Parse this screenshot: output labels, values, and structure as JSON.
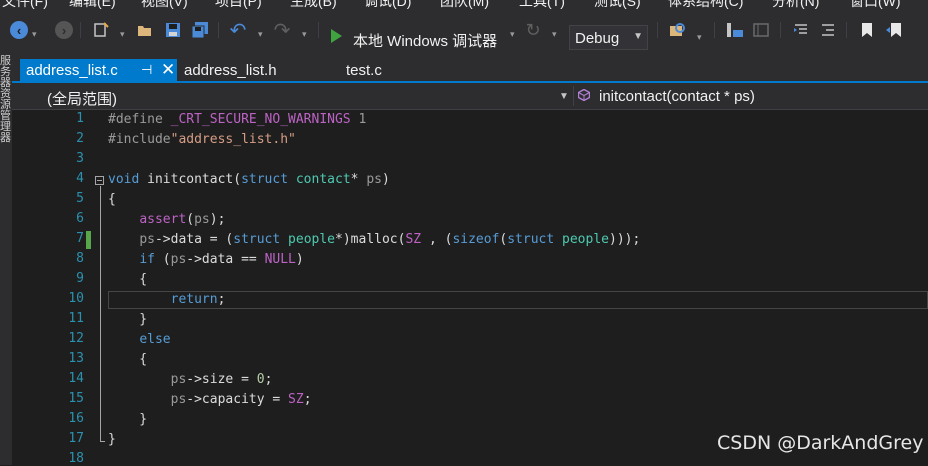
{
  "menu": [
    "文件(F)",
    "编辑(E)",
    "视图(V)",
    "项目(P)",
    "生成(B)",
    "调试(D)",
    "团队(M)",
    "工具(T)",
    "测试(S)",
    "体系结构(C)",
    "分析(N)",
    "窗口(W)"
  ],
  "toolbar": {
    "debugger_label": "本地 Windows 调试器",
    "configuration": "Debug"
  },
  "left_strip_label": "服务器资源管理器",
  "tabs": [
    {
      "label": "address_list.c",
      "active": true,
      "pinned": true
    },
    {
      "label": "address_list.h",
      "active": false
    },
    {
      "label": "test.c",
      "active": false
    }
  ],
  "navbar": {
    "scope": "(全局范围)",
    "member": "initcontact(contact * ps)"
  },
  "editor": {
    "line_numbers": [
      "1",
      "2",
      "3",
      "4",
      "5",
      "6",
      "7",
      "8",
      "9",
      "10",
      "11",
      "12",
      "13",
      "14",
      "15",
      "16",
      "17",
      "18"
    ],
    "lines": [
      [
        {
          "t": "#define ",
          "c": "pp"
        },
        {
          "t": "_CRT_SECURE_NO_WARNINGS",
          "c": "mac"
        },
        {
          "t": " 1",
          "c": "pp"
        }
      ],
      [
        {
          "t": "#include",
          "c": "pp"
        },
        {
          "t": "\"address_list.h\"",
          "c": "str"
        }
      ],
      [],
      [
        {
          "t": "void",
          "c": "kw"
        },
        {
          "t": " initcontact(",
          "c": ""
        },
        {
          "t": "struct",
          "c": "kw"
        },
        {
          "t": " ",
          "c": ""
        },
        {
          "t": "contact",
          "c": "typ"
        },
        {
          "t": "* ",
          "c": ""
        },
        {
          "t": "ps",
          "c": "par"
        },
        {
          "t": ")",
          "c": ""
        }
      ],
      [
        {
          "t": "{",
          "c": ""
        }
      ],
      [
        {
          "t": "    ",
          "c": ""
        },
        {
          "t": "assert",
          "c": "mac"
        },
        {
          "t": "(",
          "c": ""
        },
        {
          "t": "ps",
          "c": "par"
        },
        {
          "t": ");",
          "c": ""
        }
      ],
      [
        {
          "t": "    ",
          "c": ""
        },
        {
          "t": "ps",
          "c": "par"
        },
        {
          "t": "->data = (",
          "c": ""
        },
        {
          "t": "struct",
          "c": "kw"
        },
        {
          "t": " ",
          "c": ""
        },
        {
          "t": "people",
          "c": "typ"
        },
        {
          "t": "*)malloc(",
          "c": ""
        },
        {
          "t": "SZ",
          "c": "mac"
        },
        {
          "t": " , (",
          "c": ""
        },
        {
          "t": "sizeof",
          "c": "kw"
        },
        {
          "t": "(",
          "c": ""
        },
        {
          "t": "struct",
          "c": "kw"
        },
        {
          "t": " ",
          "c": ""
        },
        {
          "t": "people",
          "c": "typ"
        },
        {
          "t": ")));",
          "c": ""
        }
      ],
      [
        {
          "t": "    ",
          "c": ""
        },
        {
          "t": "if",
          "c": "kw"
        },
        {
          "t": " (",
          "c": ""
        },
        {
          "t": "ps",
          "c": "par"
        },
        {
          "t": "->data == ",
          "c": ""
        },
        {
          "t": "NULL",
          "c": "mac"
        },
        {
          "t": ")",
          "c": ""
        }
      ],
      [
        {
          "t": "    {",
          "c": ""
        }
      ],
      [
        {
          "t": "        ",
          "c": ""
        },
        {
          "t": "return",
          "c": "kw"
        },
        {
          "t": ";",
          "c": ""
        }
      ],
      [
        {
          "t": "    }",
          "c": ""
        }
      ],
      [
        {
          "t": "    ",
          "c": ""
        },
        {
          "t": "else",
          "c": "kw"
        }
      ],
      [
        {
          "t": "    {",
          "c": ""
        }
      ],
      [
        {
          "t": "        ",
          "c": ""
        },
        {
          "t": "ps",
          "c": "par"
        },
        {
          "t": "->size = ",
          "c": ""
        },
        {
          "t": "0",
          "c": "num"
        },
        {
          "t": ";",
          "c": ""
        }
      ],
      [
        {
          "t": "        ",
          "c": ""
        },
        {
          "t": "ps",
          "c": "par"
        },
        {
          "t": "->capacity = ",
          "c": ""
        },
        {
          "t": "SZ",
          "c": "mac"
        },
        {
          "t": ";",
          "c": ""
        }
      ],
      [
        {
          "t": "    }",
          "c": ""
        }
      ],
      [
        {
          "t": "}",
          "c": ""
        }
      ],
      []
    ],
    "current_line": "10",
    "changed_line": "7"
  },
  "watermark": "CSDN @DarkAndGrey",
  "colors": {
    "accent": "#007acc",
    "keyword": "#569cd6",
    "macro": "#bd63c5",
    "string": "#d69d85",
    "type": "#4ec9b0",
    "line_number": "#2b91af",
    "change_marker": "#57a64a"
  }
}
